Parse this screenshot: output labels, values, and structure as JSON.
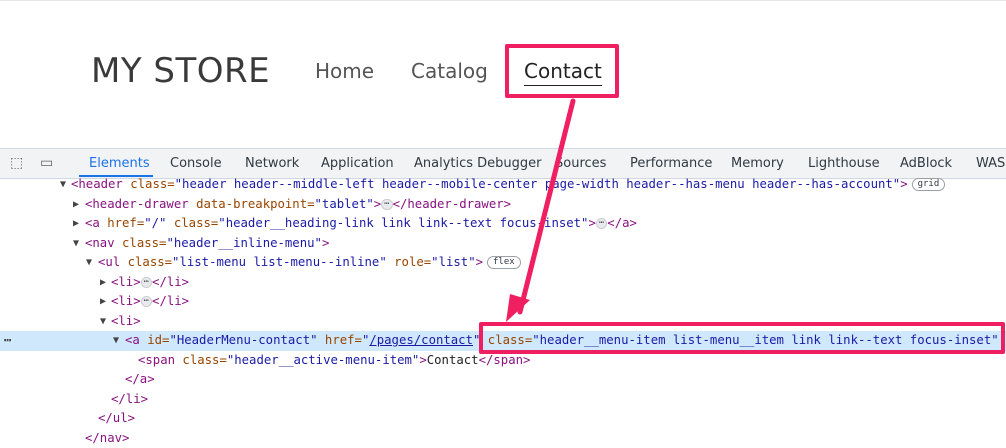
{
  "store": {
    "brand": "MY STORE",
    "nav": [
      "Home",
      "Catalog",
      "Contact"
    ]
  },
  "devtools": {
    "tabs": [
      "Elements",
      "Console",
      "Network",
      "Application",
      "Analytics Debugger",
      "Sources",
      "Performance",
      "Memory",
      "Lighthouse",
      "AdBlock",
      "WASP"
    ],
    "active_tab": "Elements",
    "tree": {
      "header_open": "<header ",
      "header_attr": "class=",
      "header_val": "\"header header--middle-left header--mobile-center page-width header--has-menu header--has-account\"",
      "header_close": ">",
      "grid_badge": "grid",
      "drawer_open": "<header-drawer ",
      "drawer_attr": "data-breakpoint=",
      "drawer_val": "\"tablet\"",
      "drawer_close_a": ">",
      "drawer_close_b": "</header-drawer>",
      "a1_open": "<a ",
      "a1_href_attr": "href=",
      "a1_href_val": "\"/\"",
      "a1_class_attr": " class=",
      "a1_class_val": "\"header__heading-link link link--text focus-inset\"",
      "a1_close_a": ">",
      "a1_close_b": "</a>",
      "nav_open": "<nav ",
      "nav_attr": "class=",
      "nav_val": "\"header__inline-menu\"",
      "nav_close": ">",
      "ul_open": "<ul ",
      "ul_attr": "class=",
      "ul_val": "\"list-menu list-menu--inline\"",
      "ul_role_attr": " role=",
      "ul_role_val": "\"list\"",
      "ul_close": ">",
      "flex_badge": "flex",
      "li_open": "<li>",
      "li_close": "</li>",
      "a2_open": "<a ",
      "a2_id_attr": "id=",
      "a2_id_val": "\"HeaderMenu-contact\"",
      "a2_href_attr": " href=",
      "a2_href_q1": "\"",
      "a2_href_link": "/pages/contact",
      "a2_href_q2": "\"",
      "a2_class_attr": " class=",
      "a2_class_val": "\"header__menu-item list-menu__item link link--text focus-inset\"",
      "span_open": "<span ",
      "span_attr": "class=",
      "span_val": "\"header__active-menu-item\"",
      "span_close": ">",
      "span_text": "Contact",
      "span_end": "</span>",
      "a_end": "</a>",
      "li_end": "</li>",
      "ul_end": "</ul>",
      "nav_end": "</nav>",
      "ellipsis": "⋯",
      "row_menu": "⋯"
    }
  },
  "colors": {
    "highlight": "#ef1f61",
    "selected_row": "#cfe8fc",
    "active_tab": "#1a73e8"
  }
}
